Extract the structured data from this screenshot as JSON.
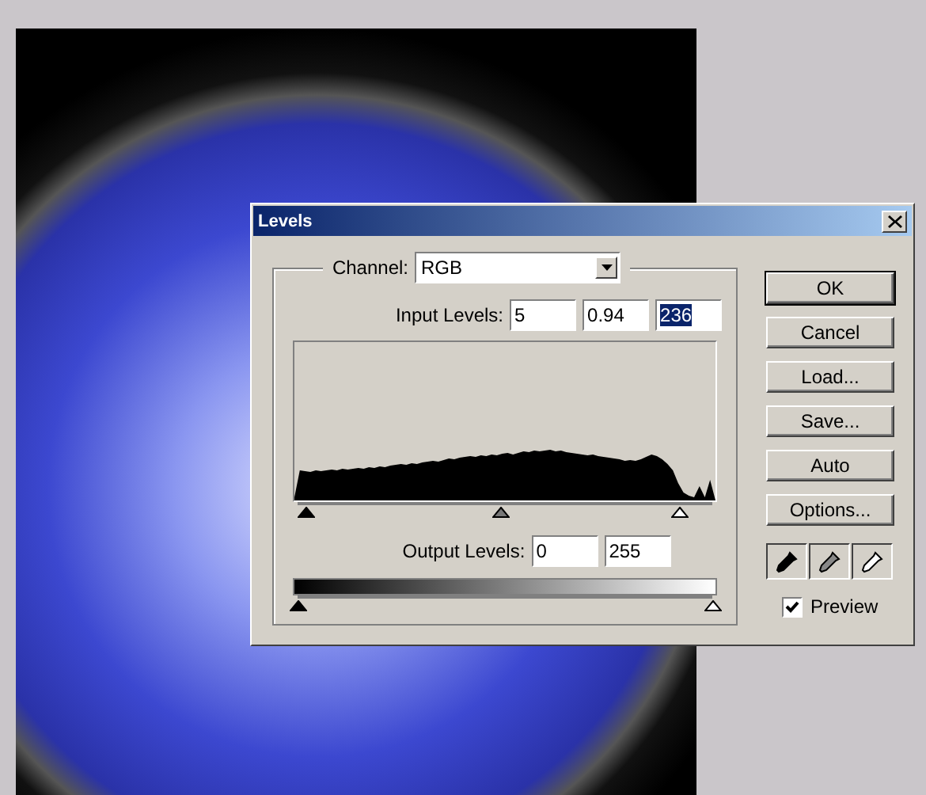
{
  "dialog": {
    "title": "Levels",
    "channel": {
      "label": "Channel:",
      "value": "RGB"
    },
    "input_levels": {
      "label": "Input Levels:",
      "fields": [
        {
          "value": "5",
          "selected": false
        },
        {
          "value": "0.94",
          "selected": false
        },
        {
          "value": "236",
          "selected": true
        }
      ],
      "sliders": [
        {
          "kind": "black",
          "level": 0.02
        },
        {
          "kind": "gray",
          "level": 0.49
        },
        {
          "kind": "white",
          "level": 0.92
        }
      ]
    },
    "output_levels": {
      "label": "Output Levels:",
      "fields": [
        {
          "value": "0",
          "selected": false
        },
        {
          "value": "255",
          "selected": false
        }
      ],
      "sliders": [
        {
          "kind": "black",
          "level": 0
        },
        {
          "kind": "white",
          "level": 1
        }
      ]
    },
    "buttons": [
      {
        "label": "OK",
        "default": true
      },
      {
        "label": "Cancel",
        "default": false
      },
      {
        "label": "Load...",
        "default": false
      },
      {
        "label": "Save...",
        "default": false
      },
      {
        "label": "Auto",
        "default": false
      },
      {
        "label": "Options...",
        "default": false
      }
    ],
    "eyedroppers": [
      {
        "kind": "black"
      },
      {
        "kind": "gray"
      },
      {
        "kind": "white"
      }
    ],
    "preview": {
      "label": "Preview",
      "checked": true
    }
  }
}
